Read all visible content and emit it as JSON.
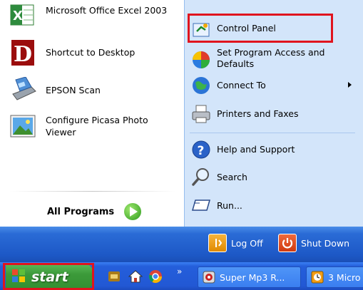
{
  "left_programs": [
    {
      "label": "Microsoft Office Excel 2003",
      "icon": "excel-icon"
    },
    {
      "label": "Shortcut to Desktop",
      "icon": "desktop-shortcut-icon"
    },
    {
      "label": "EPSON Scan",
      "icon": "scanner-icon"
    },
    {
      "label": "Configure Picasa Photo Viewer",
      "icon": "picasa-icon"
    }
  ],
  "all_programs": "All Programs",
  "right_items": [
    {
      "label": "Control Panel",
      "icon": "control-panel-icon"
    },
    {
      "label": "Set Program Access and Defaults",
      "icon": "program-access-icon"
    },
    {
      "label": "Connect To",
      "icon": "connect-to-icon"
    },
    {
      "label": "Printers and Faxes",
      "icon": "printer-icon"
    },
    {
      "label": "Help and Support",
      "icon": "help-icon"
    },
    {
      "label": "Search",
      "icon": "search-icon"
    },
    {
      "label": "Run...",
      "icon": "run-icon"
    }
  ],
  "power": {
    "log_off": "Log Off",
    "shut_down": "Shut Down"
  },
  "taskbar": {
    "start": "start",
    "chevron": "»",
    "tasks": [
      {
        "label": "Super Mp3 R...",
        "icon": "mp3-recorder-icon"
      },
      {
        "label": "3 Micro",
        "icon": "window-group-icon"
      }
    ]
  },
  "colors": {
    "highlight": "#e0141e",
    "start_green": "#3c9a3a",
    "taskbar_blue": "#245edb",
    "right_pane": "#d3e5fa"
  }
}
